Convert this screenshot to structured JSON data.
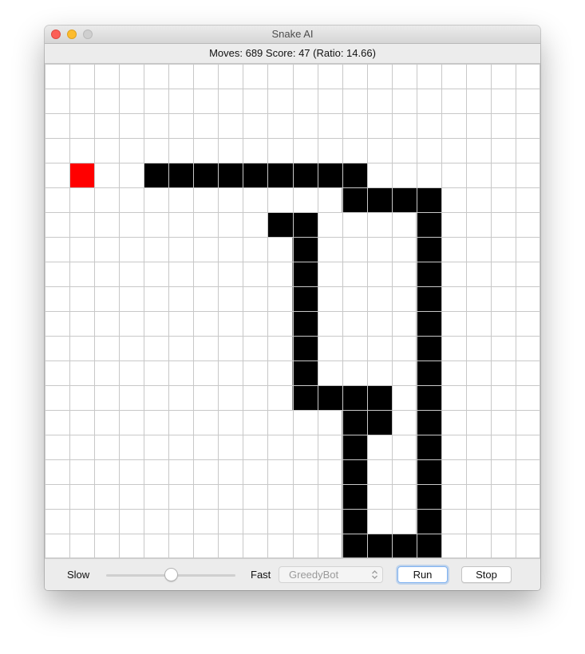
{
  "window": {
    "title": "Snake AI"
  },
  "status": {
    "text": "Moves: 689 Score: 47 (Ratio: 14.66)"
  },
  "board": {
    "cols": 20,
    "rows": 20,
    "colors": {
      "background": "#ffffff",
      "grid": "#c8c8c8",
      "snake": "#000000",
      "food": "#ff0000"
    },
    "food": [
      1,
      4
    ],
    "snake_cells": [
      [
        4,
        4
      ],
      [
        5,
        4
      ],
      [
        6,
        4
      ],
      [
        7,
        4
      ],
      [
        8,
        4
      ],
      [
        9,
        4
      ],
      [
        10,
        4
      ],
      [
        11,
        4
      ],
      [
        12,
        4
      ],
      [
        12,
        5
      ],
      [
        13,
        5
      ],
      [
        14,
        5
      ],
      [
        15,
        5
      ],
      [
        15,
        6
      ],
      [
        15,
        7
      ],
      [
        15,
        8
      ],
      [
        15,
        9
      ],
      [
        15,
        10
      ],
      [
        15,
        11
      ],
      [
        15,
        12
      ],
      [
        15,
        13
      ],
      [
        15,
        14
      ],
      [
        15,
        15
      ],
      [
        15,
        16
      ],
      [
        15,
        17
      ],
      [
        15,
        18
      ],
      [
        15,
        19
      ],
      [
        14,
        19
      ],
      [
        13,
        19
      ],
      [
        12,
        19
      ],
      [
        12,
        18
      ],
      [
        12,
        17
      ],
      [
        12,
        16
      ],
      [
        12,
        15
      ],
      [
        12,
        14
      ],
      [
        13,
        14
      ],
      [
        13,
        13
      ],
      [
        12,
        13
      ],
      [
        11,
        13
      ],
      [
        10,
        13
      ],
      [
        10,
        12
      ],
      [
        10,
        11
      ],
      [
        10,
        10
      ],
      [
        10,
        9
      ],
      [
        10,
        8
      ],
      [
        10,
        7
      ],
      [
        10,
        6
      ],
      [
        9,
        6
      ]
    ]
  },
  "controls": {
    "slow_label": "Slow",
    "fast_label": "Fast",
    "speed_value": 0.5,
    "algorithm": {
      "selected": "GreedyBot",
      "enabled": false
    },
    "run_label": "Run",
    "stop_label": "Stop"
  }
}
